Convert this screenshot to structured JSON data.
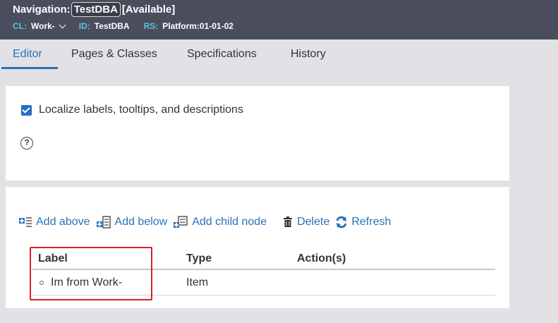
{
  "header": {
    "prefix": "Navigation:",
    "id": "TestDBA",
    "status": "[Available]",
    "meta": {
      "cl_key": "CL:",
      "cl_val": "Work-",
      "id_key": "ID:",
      "id_val": "TestDBA",
      "rs_key": "RS:",
      "rs_val": "Platform:01-01-02"
    }
  },
  "tabs": [
    {
      "label": "Editor"
    },
    {
      "label": "Pages & Classes"
    },
    {
      "label": "Specifications"
    },
    {
      "label": "History"
    }
  ],
  "settings": {
    "localize_label": "Localize labels, tooltips, and descriptions",
    "localize_checked": true,
    "help_glyph": "?"
  },
  "toolbar": {
    "add_above": "Add above",
    "add_below": "Add below",
    "add_child": "Add child node",
    "delete": "Delete",
    "refresh": "Refresh"
  },
  "grid": {
    "columns": [
      "Label",
      "Type",
      "Action(s)"
    ],
    "rows": [
      {
        "label": "Im from Work-",
        "type": "Item",
        "actions": ""
      }
    ]
  },
  "colors": {
    "header_bg": "#4a4d5c",
    "meta_key": "#5ec3dd",
    "accent": "#2a72b7",
    "highlight": "#d8202a"
  }
}
